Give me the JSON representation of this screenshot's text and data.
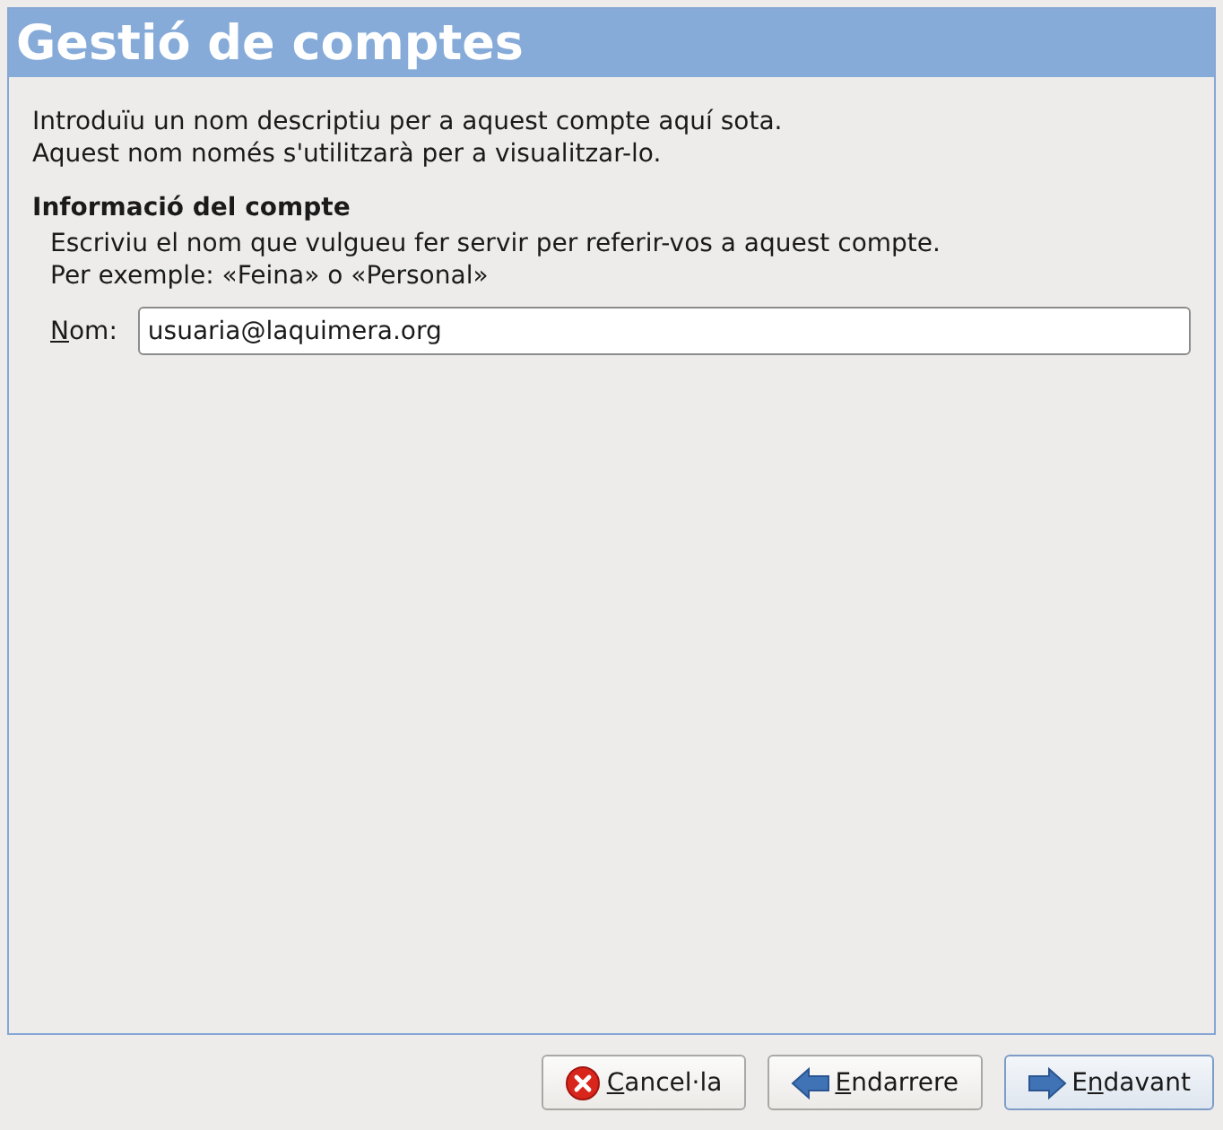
{
  "header": {
    "title": "Gestió de comptes"
  },
  "intro": [
    "Introduïu un nom descriptiu per a aquest compte aquí sota.",
    "Aquest nom només s'utilitzarà per a visualitzar-lo."
  ],
  "section": {
    "heading": "Informació del compte",
    "help": [
      "Escriviu el nom que vulgueu fer servir per referir-vos a aquest compte.",
      "Per exemple: «Feina» o «Personal»"
    ],
    "field": {
      "label": {
        "key": "N",
        "after": "om:"
      },
      "value": "usuaria@laquimera.org"
    }
  },
  "buttons": [
    {
      "kind": "cancel",
      "label": {
        "key": "C",
        "after": "ancel·la"
      },
      "default": false
    },
    {
      "kind": "back",
      "label": {
        "key": "E",
        "after": "ndarrere"
      },
      "default": false
    },
    {
      "kind": "forward",
      "label": {
        "before": "E",
        "key": "n",
        "after": "davant"
      },
      "default": true
    }
  ]
}
